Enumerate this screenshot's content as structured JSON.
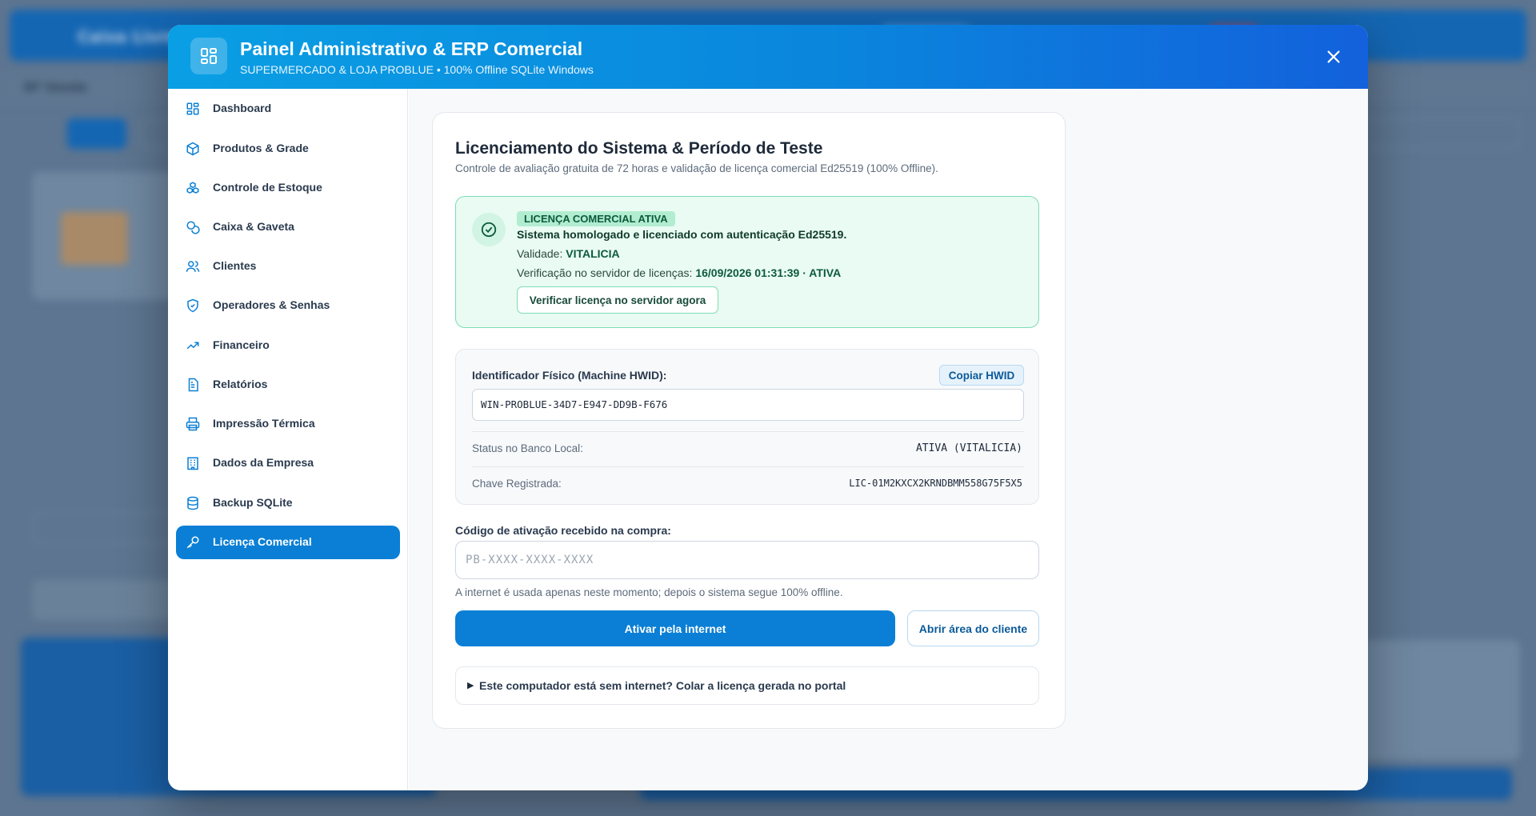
{
  "background_app": {
    "title": "Caixa Livre",
    "subtitle": "Nº Venda"
  },
  "modal": {
    "title": "Painel Administrativo & ERP Comercial",
    "subtitle": "SUPERMERCADO & LOJA PROBLUE • 100% Offline SQLite Windows",
    "header_icon": "dashboard-grid-icon",
    "close_icon": "close-icon"
  },
  "sidebar": {
    "items": [
      {
        "label": "Dashboard",
        "icon": "dashboard-icon",
        "active": false
      },
      {
        "label": "Produtos & Grade",
        "icon": "package-icon",
        "active": false
      },
      {
        "label": "Controle de Estoque",
        "icon": "boxes-icon",
        "active": false
      },
      {
        "label": "Caixa & Gaveta",
        "icon": "coins-icon",
        "active": false
      },
      {
        "label": "Clientes",
        "icon": "users-icon",
        "active": false
      },
      {
        "label": "Operadores & Senhas",
        "icon": "shield-icon",
        "active": false
      },
      {
        "label": "Financeiro",
        "icon": "trending-up-icon",
        "active": false
      },
      {
        "label": "Relatórios",
        "icon": "report-icon",
        "active": false
      },
      {
        "label": "Impressão Térmica",
        "icon": "printer-icon",
        "active": false
      },
      {
        "label": "Dados da Empresa",
        "icon": "building-icon",
        "active": false
      },
      {
        "label": "Backup SQLite",
        "icon": "database-icon",
        "active": false
      },
      {
        "label": "Licença Comercial",
        "icon": "key-icon",
        "active": true
      }
    ]
  },
  "license": {
    "title": "Licenciamento do Sistema & Período de Teste",
    "subtitle": "Controle de avaliação gratuita de 72 horas e validação de licença comercial Ed25519 (100% Offline).",
    "status_badge": "LICENÇA COMERCIAL ATIVA",
    "status_line": "Sistema homologado e licenciado com autenticação Ed25519.",
    "validity_label": "Validade:",
    "validity_value": "VITALICIA",
    "verification_label": "Verificação no servidor de licenças:",
    "verification_value": "16/09/2026 01:31:39 · ATIVA",
    "verify_button": "Verificar licença no servidor agora",
    "status_color": "#0d5a3c"
  },
  "hardware": {
    "hwid_label": "Identificador Físico (Machine HWID):",
    "copy_button": "Copiar HWID",
    "hwid_value": "WIN-PROBLUE-34D7-E947-DD9B-F676",
    "status_label": "Status no Banco Local:",
    "status_value": "ATIVA (VITALICIA)",
    "key_label": "Chave Registrada:",
    "key_value": "LIC-01M2KXCX2KRNDBMM558G75F5X5"
  },
  "activation": {
    "label": "Código de ativação recebido na compra:",
    "value": "",
    "placeholder": "PB-XXXX-XXXX-XXXX",
    "note": "A internet é usada apenas neste momento; depois o sistema segue 100% offline.",
    "activate_button": "Ativar pela internet",
    "client_button": "Abrir área do cliente",
    "offline_marker": "▶",
    "offline_label": "Este computador está sem internet? Colar a licença gerada no portal"
  },
  "colors": {
    "accent": "#0a7fd5",
    "header_gradient_start": "#0a9fe4",
    "header_gradient_end": "#1361dc",
    "success_bg": "#e9fbf3",
    "success_border": "#7fdcb4"
  }
}
